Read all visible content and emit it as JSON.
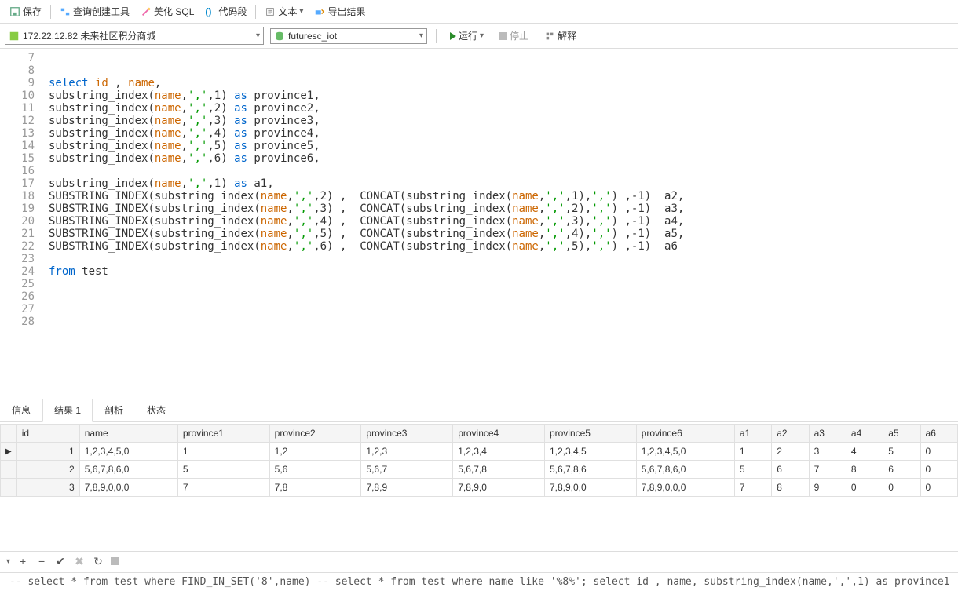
{
  "toolbar": {
    "save": "保存",
    "query_builder": "查询创建工具",
    "beautify": "美化 SQL",
    "snippets": "代码段",
    "text": "文本",
    "export": "导出结果"
  },
  "selectors": {
    "connection": "172.22.12.82  未来社区积分商城",
    "database": "futuresc_iot",
    "run": "运行",
    "stop": "停止",
    "explain": "解释"
  },
  "editor": {
    "lines": [
      {
        "n": 7,
        "raw": ""
      },
      {
        "n": 8,
        "raw": ""
      },
      {
        "n": 9,
        "tokens": [
          [
            "kw",
            "select"
          ],
          [
            "",
            ""
          ],
          [
            "fld",
            " id"
          ],
          [
            "",
            " , "
          ],
          [
            "fld",
            "name"
          ],
          [
            "",
            ","
          ]
        ]
      },
      {
        "n": 10,
        "tokens": [
          [
            "fn",
            "substring_index"
          ],
          [
            "",
            "("
          ],
          [
            "fld",
            "name"
          ],
          [
            "",
            ","
          ],
          [
            "str",
            "','"
          ],
          [
            "",
            ","
          ],
          [
            "num",
            "1"
          ],
          [
            "",
            ") "
          ],
          [
            "kw",
            "as"
          ],
          [
            "",
            " province1,"
          ]
        ]
      },
      {
        "n": 11,
        "tokens": [
          [
            "fn",
            "substring_index"
          ],
          [
            "",
            "("
          ],
          [
            "fld",
            "name"
          ],
          [
            "",
            ","
          ],
          [
            "str",
            "','"
          ],
          [
            "",
            ","
          ],
          [
            "num",
            "2"
          ],
          [
            "",
            ") "
          ],
          [
            "kw",
            "as"
          ],
          [
            "",
            " province2,"
          ]
        ]
      },
      {
        "n": 12,
        "tokens": [
          [
            "fn",
            "substring_index"
          ],
          [
            "",
            "("
          ],
          [
            "fld",
            "name"
          ],
          [
            "",
            ","
          ],
          [
            "str",
            "','"
          ],
          [
            "",
            ","
          ],
          [
            "num",
            "3"
          ],
          [
            "",
            ") "
          ],
          [
            "kw",
            "as"
          ],
          [
            "",
            " province3,"
          ]
        ]
      },
      {
        "n": 13,
        "tokens": [
          [
            "fn",
            "substring_index"
          ],
          [
            "",
            "("
          ],
          [
            "fld",
            "name"
          ],
          [
            "",
            ","
          ],
          [
            "str",
            "','"
          ],
          [
            "",
            ","
          ],
          [
            "num",
            "4"
          ],
          [
            "",
            ") "
          ],
          [
            "kw",
            "as"
          ],
          [
            "",
            " province4,"
          ]
        ]
      },
      {
        "n": 14,
        "tokens": [
          [
            "fn",
            "substring_index"
          ],
          [
            "",
            "("
          ],
          [
            "fld",
            "name"
          ],
          [
            "",
            ","
          ],
          [
            "str",
            "','"
          ],
          [
            "",
            ","
          ],
          [
            "num",
            "5"
          ],
          [
            "",
            ") "
          ],
          [
            "kw",
            "as"
          ],
          [
            "",
            " province5,"
          ]
        ]
      },
      {
        "n": 15,
        "tokens": [
          [
            "fn",
            "substring_index"
          ],
          [
            "",
            "("
          ],
          [
            "fld",
            "name"
          ],
          [
            "",
            ","
          ],
          [
            "str",
            "','"
          ],
          [
            "",
            ","
          ],
          [
            "num",
            "6"
          ],
          [
            "",
            ") "
          ],
          [
            "kw",
            "as"
          ],
          [
            "",
            " province6,"
          ]
        ]
      },
      {
        "n": 16,
        "raw": ""
      },
      {
        "n": 17,
        "tokens": [
          [
            "fn",
            "substring_index"
          ],
          [
            "",
            "("
          ],
          [
            "fld",
            "name"
          ],
          [
            "",
            ","
          ],
          [
            "str",
            "','"
          ],
          [
            "",
            ","
          ],
          [
            "num",
            "1"
          ],
          [
            "",
            ") "
          ],
          [
            "kw",
            "as"
          ],
          [
            "",
            " a1,"
          ]
        ]
      },
      {
        "n": 18,
        "tokens": [
          [
            "fn",
            "SUBSTRING_INDEX"
          ],
          [
            "",
            "("
          ],
          [
            "fn",
            "substring_index"
          ],
          [
            "",
            "("
          ],
          [
            "fld",
            "name"
          ],
          [
            "",
            ","
          ],
          [
            "str",
            "','"
          ],
          [
            "",
            ","
          ],
          [
            "num",
            "2"
          ],
          [
            "",
            ") ,  "
          ],
          [
            "fn",
            "CONCAT"
          ],
          [
            "",
            "("
          ],
          [
            "fn",
            "substring_index"
          ],
          [
            "",
            "("
          ],
          [
            "fld",
            "name"
          ],
          [
            "",
            ","
          ],
          [
            "str",
            "','"
          ],
          [
            "",
            ","
          ],
          [
            "num",
            "1"
          ],
          [
            "",
            "),"
          ],
          [
            "str",
            "','"
          ],
          [
            "",
            ") ,"
          ],
          [
            "num",
            "-1"
          ],
          [
            "",
            ")  a2,"
          ]
        ]
      },
      {
        "n": 19,
        "tokens": [
          [
            "fn",
            "SUBSTRING_INDEX"
          ],
          [
            "",
            "("
          ],
          [
            "fn",
            "substring_index"
          ],
          [
            "",
            "("
          ],
          [
            "fld",
            "name"
          ],
          [
            "",
            ","
          ],
          [
            "str",
            "','"
          ],
          [
            "",
            ","
          ],
          [
            "num",
            "3"
          ],
          [
            "",
            ") ,  "
          ],
          [
            "fn",
            "CONCAT"
          ],
          [
            "",
            "("
          ],
          [
            "fn",
            "substring_index"
          ],
          [
            "",
            "("
          ],
          [
            "fld",
            "name"
          ],
          [
            "",
            ","
          ],
          [
            "str",
            "','"
          ],
          [
            "",
            ","
          ],
          [
            "num",
            "2"
          ],
          [
            "",
            "),"
          ],
          [
            "str",
            "','"
          ],
          [
            "",
            ") ,"
          ],
          [
            "num",
            "-1"
          ],
          [
            "",
            ")  a3,"
          ]
        ]
      },
      {
        "n": 20,
        "tokens": [
          [
            "fn",
            "SUBSTRING_INDEX"
          ],
          [
            "",
            "("
          ],
          [
            "fn",
            "substring_index"
          ],
          [
            "",
            "("
          ],
          [
            "fld",
            "name"
          ],
          [
            "",
            ","
          ],
          [
            "str",
            "','"
          ],
          [
            "",
            ","
          ],
          [
            "num",
            "4"
          ],
          [
            "",
            ") ,  "
          ],
          [
            "fn",
            "CONCAT"
          ],
          [
            "",
            "("
          ],
          [
            "fn",
            "substring_index"
          ],
          [
            "",
            "("
          ],
          [
            "fld",
            "name"
          ],
          [
            "",
            ","
          ],
          [
            "str",
            "','"
          ],
          [
            "",
            ","
          ],
          [
            "num",
            "3"
          ],
          [
            "",
            "),"
          ],
          [
            "str",
            "','"
          ],
          [
            "",
            ") ,"
          ],
          [
            "num",
            "-1"
          ],
          [
            "",
            ")  a4,"
          ]
        ]
      },
      {
        "n": 21,
        "tokens": [
          [
            "fn",
            "SUBSTRING_INDEX"
          ],
          [
            "",
            "("
          ],
          [
            "fn",
            "substring_index"
          ],
          [
            "",
            "("
          ],
          [
            "fld",
            "name"
          ],
          [
            "",
            ","
          ],
          [
            "str",
            "','"
          ],
          [
            "",
            ","
          ],
          [
            "num",
            "5"
          ],
          [
            "",
            ") ,  "
          ],
          [
            "fn",
            "CONCAT"
          ],
          [
            "",
            "("
          ],
          [
            "fn",
            "substring_index"
          ],
          [
            "",
            "("
          ],
          [
            "fld",
            "name"
          ],
          [
            "",
            ","
          ],
          [
            "str",
            "','"
          ],
          [
            "",
            ","
          ],
          [
            "num",
            "4"
          ],
          [
            "",
            "),"
          ],
          [
            "str",
            "','"
          ],
          [
            "",
            ") ,"
          ],
          [
            "num",
            "-1"
          ],
          [
            "",
            ")  a5,"
          ]
        ]
      },
      {
        "n": 22,
        "tokens": [
          [
            "fn",
            "SUBSTRING_INDEX"
          ],
          [
            "",
            "("
          ],
          [
            "fn",
            "substring_index"
          ],
          [
            "",
            "("
          ],
          [
            "fld",
            "name"
          ],
          [
            "",
            ","
          ],
          [
            "str",
            "','"
          ],
          [
            "",
            ","
          ],
          [
            "num",
            "6"
          ],
          [
            "",
            ") ,  "
          ],
          [
            "fn",
            "CONCAT"
          ],
          [
            "",
            "("
          ],
          [
            "fn",
            "substring_index"
          ],
          [
            "",
            "("
          ],
          [
            "fld",
            "name"
          ],
          [
            "",
            ","
          ],
          [
            "str",
            "','"
          ],
          [
            "",
            ","
          ],
          [
            "num",
            "5"
          ],
          [
            "",
            "),"
          ],
          [
            "str",
            "','"
          ],
          [
            "",
            ") ,"
          ],
          [
            "num",
            "-1"
          ],
          [
            "",
            ")  a6"
          ]
        ]
      },
      {
        "n": 23,
        "raw": ""
      },
      {
        "n": 24,
        "tokens": [
          [
            "kw",
            "from"
          ],
          [
            "",
            " test"
          ]
        ]
      },
      {
        "n": 25,
        "raw": ""
      },
      {
        "n": 26,
        "raw": ""
      },
      {
        "n": 27,
        "raw": ""
      },
      {
        "n": 28,
        "raw": ""
      }
    ]
  },
  "resultTabs": {
    "info": "信息",
    "result1": "结果 1",
    "profile": "剖析",
    "status": "状态"
  },
  "grid": {
    "headers": [
      "id",
      "name",
      "province1",
      "province2",
      "province3",
      "province4",
      "province5",
      "province6",
      "a1",
      "a2",
      "a3",
      "a4",
      "a5",
      "a6"
    ],
    "rows": [
      [
        "1",
        "1,2,3,4,5,0",
        "1",
        "1,2",
        "1,2,3",
        "1,2,3,4",
        "1,2,3,4,5",
        "1,2,3,4,5,0",
        "1",
        "2",
        "3",
        "4",
        "5",
        "0"
      ],
      [
        "2",
        "5,6,7,8,6,0",
        "5",
        "5,6",
        "5,6,7",
        "5,6,7,8",
        "5,6,7,8,6",
        "5,6,7,8,6,0",
        "5",
        "6",
        "7",
        "8",
        "6",
        "0"
      ],
      [
        "3",
        "7,8,9,0,0,0",
        "7",
        "7,8",
        "7,8,9",
        "7,8,9,0",
        "7,8,9,0,0",
        "7,8,9,0,0,0",
        "7",
        "8",
        "9",
        "0",
        "0",
        "0"
      ]
    ]
  },
  "statusbar": "-- select * from test where FIND_IN_SET('8',name)   -- select * from test where name like '%8%';     select id , name,  substring_index(name,',',1) as province1"
}
